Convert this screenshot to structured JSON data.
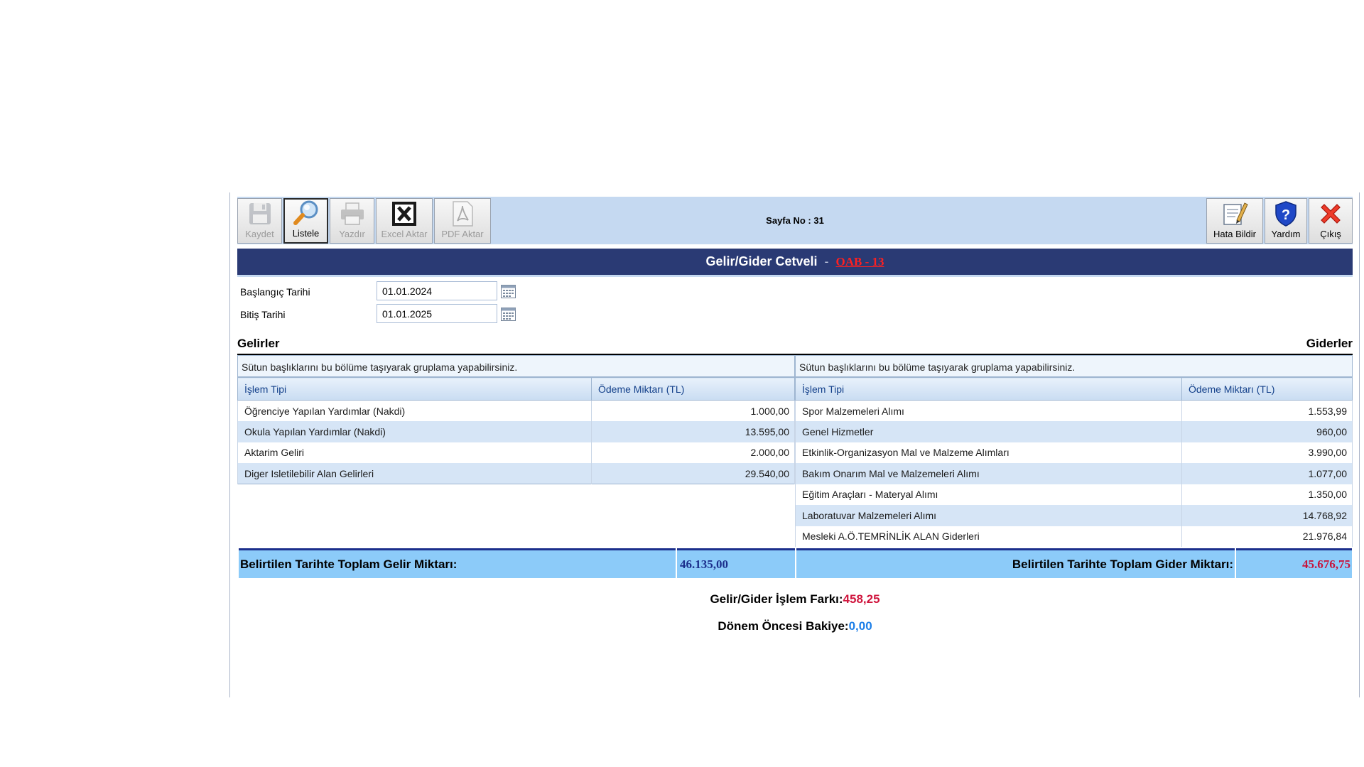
{
  "toolbar": {
    "left_buttons": [
      {
        "label": "Kaydet",
        "icon": "floppy-disk-icon",
        "state": "disabled"
      },
      {
        "label": "Listele",
        "icon": "magnifier-icon",
        "state": "active"
      },
      {
        "label": "Yazdır",
        "icon": "printer-icon",
        "state": "disabled"
      },
      {
        "label": "Excel Aktar",
        "icon": "excel-icon",
        "state": "disabled"
      },
      {
        "label": "PDF Aktar",
        "icon": "pdf-icon",
        "state": "disabled"
      }
    ],
    "page_no": "Sayfa No : 31",
    "right_buttons": [
      {
        "label": "Hata Bildir",
        "icon": "report-error-icon"
      },
      {
        "label": "Yardım",
        "icon": "help-icon"
      },
      {
        "label": "Çıkış",
        "icon": "exit-icon"
      }
    ]
  },
  "header": {
    "title": "Gelir/Gider Cetveli",
    "separator": "-",
    "code": "OAB - 13"
  },
  "form": {
    "start_label": "Başlangıç Tarihi",
    "start_value": "01.01.2024",
    "end_label": "Bitiş Tarihi",
    "end_value": "01.01.2025"
  },
  "sections": {
    "income_title": "Gelirler",
    "expense_title": "Giderler"
  },
  "income_grid": {
    "group_hint": "Sütun başlıklarını bu bölüme taşıyarak gruplama yapabilirsiniz.",
    "columns": [
      "İşlem Tipi",
      "Ödeme Miktarı (TL)"
    ],
    "rows": [
      [
        "Öğrenciye Yapılan Yardımlar (Nakdi)",
        "1.000,00"
      ],
      [
        "Okula Yapılan Yardımlar (Nakdi)",
        "13.595,00"
      ],
      [
        "Aktarim Geliri",
        "2.000,00"
      ],
      [
        "Diger Isletilebilir Alan Gelirleri",
        "29.540,00"
      ]
    ]
  },
  "expense_grid": {
    "group_hint": "Sütun başlıklarını bu bölüme taşıyarak gruplama yapabilirsiniz.",
    "columns": [
      "İşlem Tipi",
      "Ödeme Miktarı (TL)"
    ],
    "rows": [
      [
        "Spor Malzemeleri Alımı",
        "1.553,99"
      ],
      [
        "Genel Hizmetler",
        "960,00"
      ],
      [
        "Etkinlik-Organizasyon Mal ve Malzeme Alımları",
        "3.990,00"
      ],
      [
        "Bakım Onarım Mal ve Malzemeleri Alımı",
        "1.077,00"
      ],
      [
        "Eğitim Araçları - Materyal Alımı",
        "1.350,00"
      ],
      [
        "Laboratuvar Malzemeleri Alımı",
        "14.768,92"
      ],
      [
        "Mesleki A.Ö.TEMRİNLİK ALAN Giderleri",
        "21.976,84"
      ]
    ]
  },
  "totals": {
    "income_label": "Belirtilen Tarihte Toplam Gelir Miktarı:",
    "income_value": "46.135,00",
    "expense_label": "Belirtilen Tarihte Toplam Gider Miktarı:",
    "expense_value": "45.676,75"
  },
  "summary": {
    "diff_label": "Gelir/Gider İşlem Farkı:",
    "diff_value": "458,25",
    "prev_label": "Dönem Öncesi Bakiye:",
    "prev_value": "0,00"
  },
  "colors": {
    "title_bg": "#2a3a74",
    "toolbar_bg": "#c5d9f1",
    "totals_bg": "#8ccbf9",
    "income_total": "#1c2f8c",
    "expense_total": "#c8143c",
    "diff_value": "#d0163e",
    "prev_value": "#1d7fe8"
  }
}
